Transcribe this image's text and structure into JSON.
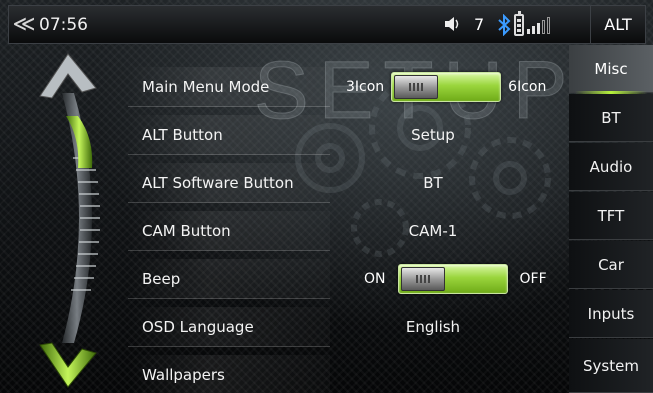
{
  "status_bar": {
    "back_symbol": "≪",
    "time": "07:56",
    "volume_level": "7",
    "alt_label": "ALT",
    "bluetooth_connected": true,
    "signal_bars_on": 3,
    "signal_bars_total": 5
  },
  "watermark": "SETUP",
  "settings": [
    {
      "label": "Main Menu Mode",
      "type": "toggle",
      "left_label": "3Icon",
      "right_label": "6Icon"
    },
    {
      "label": "ALT Button",
      "type": "value",
      "value": "Setup"
    },
    {
      "label": "ALT Software Button",
      "type": "value",
      "value": "BT"
    },
    {
      "label": "CAM Button",
      "type": "value",
      "value": "CAM-1"
    },
    {
      "label": "Beep",
      "type": "toggle",
      "left_label": "ON",
      "right_label": "OFF"
    },
    {
      "label": "OSD Language",
      "type": "value",
      "value": "English"
    },
    {
      "label": "Wallpapers",
      "type": "value",
      "value": ""
    }
  ],
  "categories": [
    {
      "label": "Misc",
      "active": true
    },
    {
      "label": "BT",
      "active": false
    },
    {
      "label": "Audio",
      "active": false
    },
    {
      "label": "TFT",
      "active": false
    },
    {
      "label": "Car",
      "active": false
    },
    {
      "label": "Inputs",
      "active": false
    },
    {
      "label": "System",
      "active": false
    }
  ],
  "colors": {
    "accent_green": "#9ad53c",
    "background": "#0c0e10"
  },
  "icons": {
    "back": "double-chevron-left-icon",
    "volume": "speaker-icon",
    "bluetooth": "bluetooth-icon",
    "battery": "battery-icon",
    "signal": "signal-bars-icon",
    "scroll_up": "scroll-up-arrow-icon",
    "scroll_down": "scroll-down-arrow-icon"
  }
}
